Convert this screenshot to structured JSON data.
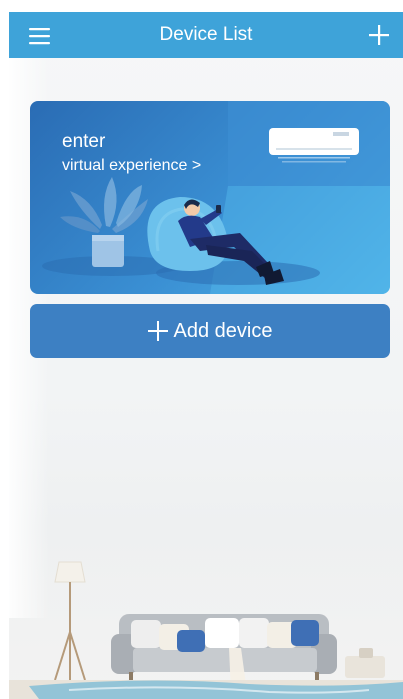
{
  "header": {
    "title": "Device List"
  },
  "banner": {
    "line1": "enter",
    "line2": "virtual experience >"
  },
  "add_device": {
    "label": "Add device"
  },
  "colors": {
    "header": "#3ea3d9",
    "banner_start": "#2a6cb4",
    "banner_end": "#4fb3e8",
    "add_button": "#3d80c3"
  },
  "icons": {
    "menu": "hamburger-menu-icon",
    "add_top": "plus-icon",
    "add_device": "plus-icon"
  }
}
